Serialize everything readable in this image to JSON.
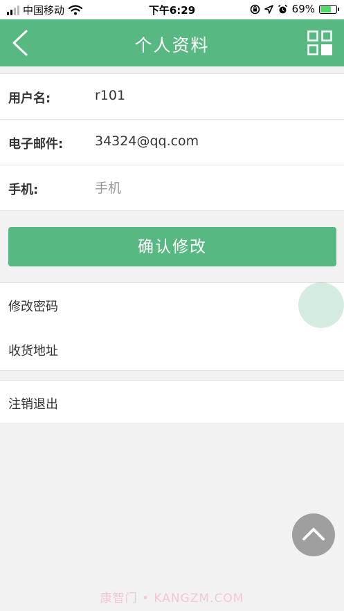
{
  "status_bar": {
    "carrier": "中国移动",
    "time": "下午6:29",
    "battery_percent": "69%",
    "battery_level": 0.69
  },
  "header": {
    "title": "个人资料",
    "back_icon": "chevron-left-icon",
    "menu_icon": "grid-icon"
  },
  "form": {
    "username_label": "用户名:",
    "username_value": "r101",
    "email_label": "电子邮件:",
    "email_value": "34324@qq.com",
    "phone_label": "手机:",
    "phone_placeholder": "手机",
    "phone_value": ""
  },
  "confirm_button": "确认修改",
  "menu": {
    "change_password": "修改密码",
    "shipping_address": "收货地址",
    "logout": "注销退出"
  },
  "watermark": "康智门 • KANGZM.COM",
  "colors": {
    "accent": "#58b882",
    "background": "#f2f2f2"
  }
}
